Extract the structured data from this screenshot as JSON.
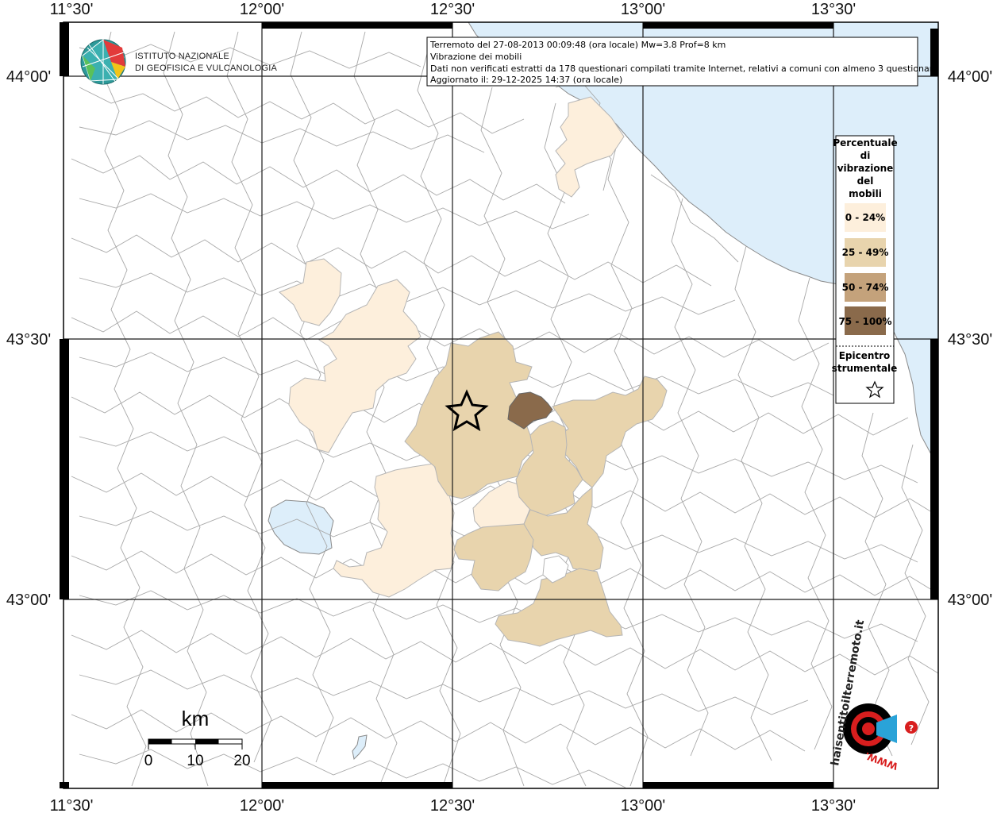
{
  "header": {
    "line1": "Terremoto del 27-08-2013 00:09:48 (ora locale) Mw=3.8 Prof=8 km",
    "line2": "Vibrazione dei mobili",
    "line3": "Dati non verificati estratti da 178 questionari compilati tramite Internet, relativi a comuni con almeno 3 questionari.",
    "line4": "Aggiornato il: 29-12-2025 14:37 (ora locale)"
  },
  "logo": {
    "line1": "ISTITUTO NAZIONALE",
    "line2": "DI GEOFISICA E VULCANOLOGIA"
  },
  "axes": {
    "top": [
      "11°30'",
      "12°00'",
      "12°30'",
      "13°00'",
      "13°30'"
    ],
    "bottom": [
      "11°30'",
      "12°00'",
      "12°30'",
      "13°00'",
      "13°30'"
    ],
    "left": [
      "44°00'",
      "43°30'",
      "43°00'"
    ],
    "right": [
      "44°00'",
      "43°30'",
      "43°00'"
    ]
  },
  "legend": {
    "title_lines": [
      "Percentuale",
      "di",
      "vibrazione",
      "del",
      "mobili"
    ],
    "classes": [
      {
        "label": "0 - 24%",
        "color": "#fdefdc"
      },
      {
        "label": "25 - 49%",
        "color": "#e8d4ad"
      },
      {
        "label": "50 - 74%",
        "color": "#c4a27b"
      },
      {
        "label": "75 - 100%",
        "color": "#8a6a4b"
      }
    ],
    "epicenter_lines": [
      "Epicentro",
      "strumentale"
    ]
  },
  "scale_bar": {
    "unit": "km",
    "ticks": [
      "0",
      "10",
      "20"
    ]
  },
  "badge": {
    "text": "haisentitoilterremoto.it",
    "url": "WWW."
  },
  "colors": {
    "sea": "#ddeefa",
    "border": "#a8a8a8",
    "grid": "#1a1a1a"
  }
}
